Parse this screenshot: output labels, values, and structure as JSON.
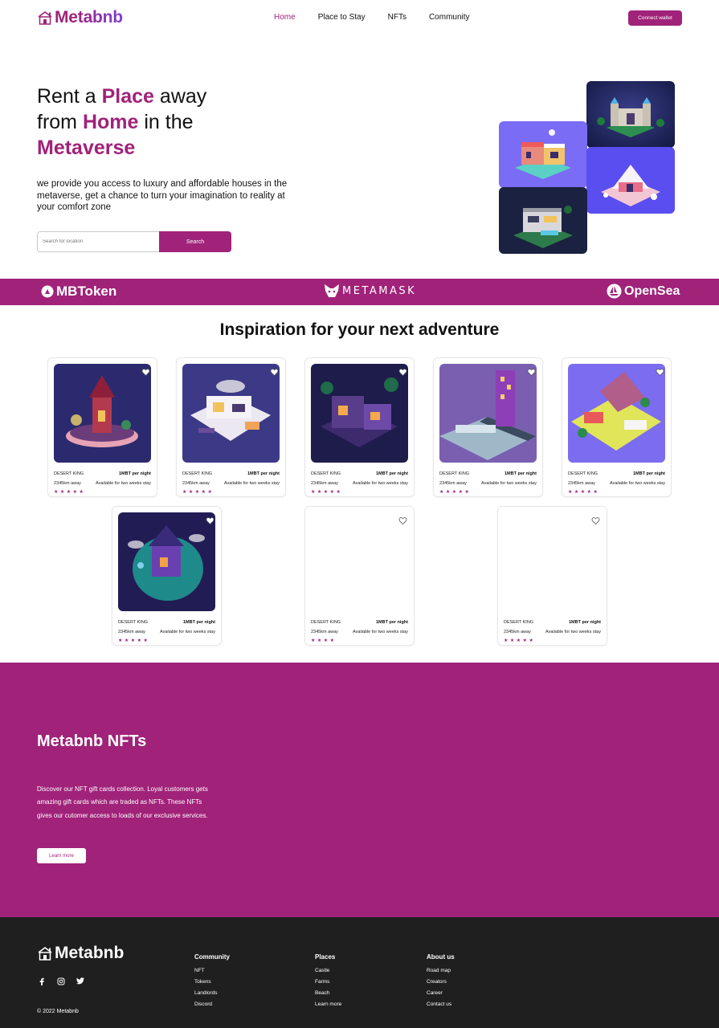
{
  "nav": {
    "logo": "Metabnb",
    "links": [
      "Home",
      "Place to Stay",
      "NFTs",
      "Community"
    ],
    "connect_wallet": "Connect wallet"
  },
  "hero": {
    "title_1": "Rent a",
    "title_hl_1": "Place",
    "title_2": "away",
    "title_3": "from",
    "title_hl_2": "Home",
    "title_4": "in the",
    "title_hl_3": "Metaverse",
    "subtitle": "we provide you access to luxury and affordable houses in the metaverse, get a chance to turn your imagination to reality at your comfort zone",
    "search_placeholder": "Search for location",
    "search_button": "Search"
  },
  "partners": [
    "MBToken",
    "METAMASK",
    "OpenSea"
  ],
  "inspiration": {
    "title": "Inspiration for your next adventure",
    "cards": [
      {
        "name": "DESERT KING",
        "price": "1MBT per night",
        "distance": "2345km away",
        "availability": "Available for two weeks stay",
        "rating": 5
      },
      {
        "name": "DESERT KING",
        "price": "1MBT per night",
        "distance": "2345km away",
        "availability": "Available for two weeks stay",
        "rating": 5
      },
      {
        "name": "DESERT KING",
        "price": "1MBT per night",
        "distance": "2345km away",
        "availability": "Available for two weeks stay",
        "rating": 5
      },
      {
        "name": "DESERT KING",
        "price": "1MBT per night",
        "distance": "2345km away",
        "availability": "Available for two weeks stay",
        "rating": 5
      },
      {
        "name": "DESERT KING",
        "price": "1MBT per night",
        "distance": "2345km away",
        "availability": "Available for two weeks stay",
        "rating": 5
      },
      {
        "name": "DESERT KING",
        "price": "1MBT per night",
        "distance": "2345km away",
        "availability": "Available for two weeks stay",
        "rating": 5
      },
      {
        "name": "DESERT KING",
        "price": "1MBT per night",
        "distance": "2345km away",
        "availability": "Available for two weeks stay",
        "rating": 4
      },
      {
        "name": "DESERT KING",
        "price": "1MBT per night",
        "distance": "2345km away",
        "availability": "Available for two weeks stay",
        "rating": 5
      }
    ]
  },
  "nft_section": {
    "title": "Metabnb NFTs",
    "text": "Discover our NFT gift cards collection. Loyal customers gets amazing gift cards which are traded as NFTs. These NFTs gives our cutomer access to loads of our exclusive services.",
    "button": "Learn more"
  },
  "footer": {
    "logo": "Metabnb",
    "copyright": "© 2022 Metabnb",
    "socials": [
      "facebook-icon",
      "instagram-icon",
      "twitter-icon"
    ],
    "columns": [
      {
        "heading": "Community",
        "items": [
          "NFT",
          "Tokens",
          "Landlords",
          "Discord"
        ]
      },
      {
        "heading": "Places",
        "items": [
          "Castle",
          "Farms",
          "Beach",
          "Learn more"
        ]
      },
      {
        "heading": "About us",
        "items": [
          "Road map",
          "Creators",
          "Career",
          "Contact us"
        ]
      }
    ]
  },
  "colors": {
    "brand": "#A02279",
    "footer_bg": "#1f1f1f",
    "accent_purple": "#7e3fd9"
  }
}
